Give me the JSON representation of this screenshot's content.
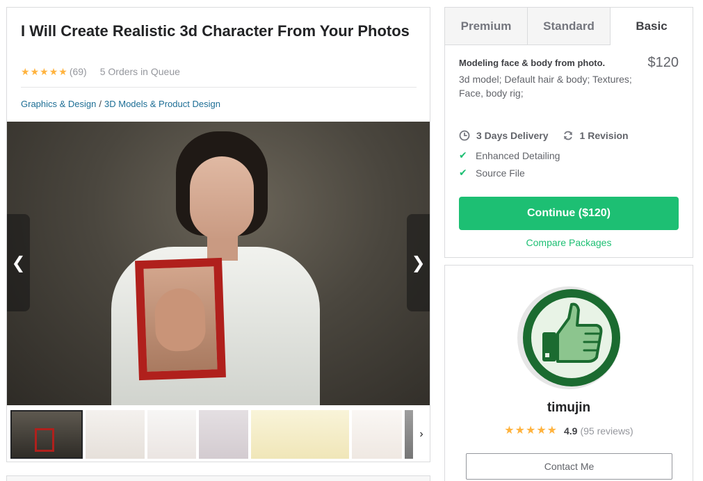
{
  "gig": {
    "title": "I Will Create Realistic 3d Character From Your Photos",
    "rating_stars": 5,
    "rating_count": "(69)",
    "orders_in_queue": "5 Orders in Queue",
    "breadcrumb": {
      "category": "Graphics & Design",
      "separator": "/",
      "subcategory": "3D Models & Product Design"
    }
  },
  "gallery": {
    "prev_icon": "chevron-left-icon",
    "next_icon": "chevron-right-icon",
    "prev_glyph": "❮",
    "next_glyph": "❯",
    "thumbs_next_glyph": "›",
    "thumbnail_count": 7
  },
  "package": {
    "tabs": [
      {
        "label": "Premium",
        "active": false
      },
      {
        "label": "Standard",
        "active": false
      },
      {
        "label": "Basic",
        "active": true
      }
    ],
    "title": "Modeling face & body from photo.",
    "price": "$120",
    "description": "3d model; Default hair & body; Textures; Face, body rig;",
    "delivery": "3 Days Delivery",
    "revisions": "1 Revision",
    "features": [
      "Enhanced Detailing",
      "Source File"
    ],
    "continue_label": "Continue ($120)",
    "compare_label": "Compare Packages"
  },
  "seller": {
    "name": "timujin",
    "rating_stars": 5,
    "score": "4.9",
    "reviews": "(95 reviews)",
    "contact_label": "Contact Me",
    "avatar_icon": "thumbs-up-icon"
  },
  "colors": {
    "accent": "#1dbf73",
    "star": "#ffb33e",
    "link": "#1d6e95",
    "avatar_green": "#1b6b30"
  }
}
